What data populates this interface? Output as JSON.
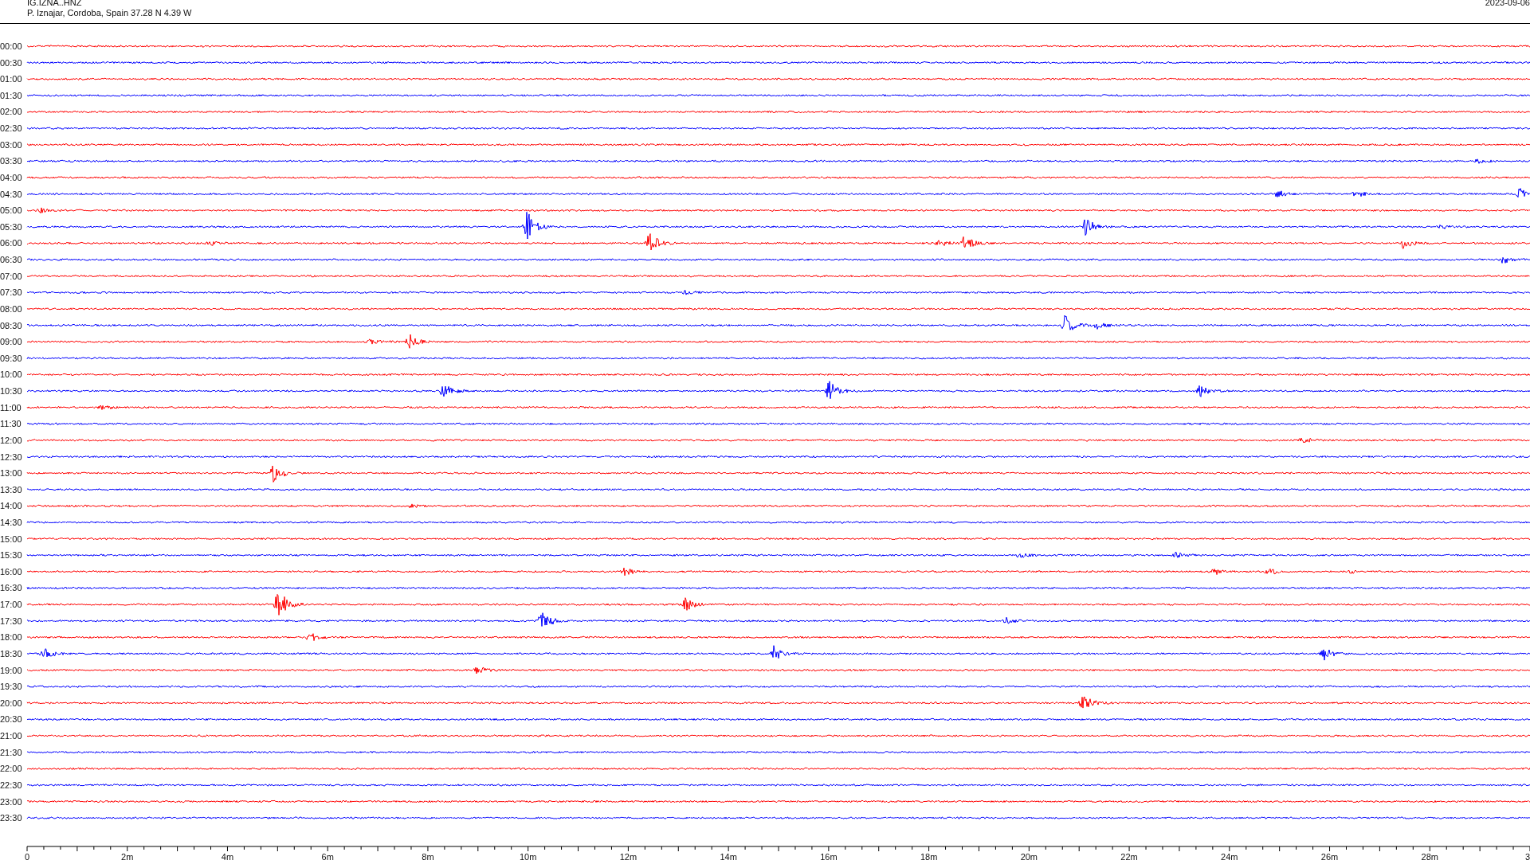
{
  "header": {
    "station": "IG.IZNA..HNZ",
    "location": "P. Iznajar, Cordoba, Spain  37.28 N 4.39 W",
    "date": "2023-09-06"
  },
  "rows": [
    {
      "label": "00:00",
      "color": "#ff0000"
    },
    {
      "label": "00:30",
      "color": "#0000ff"
    },
    {
      "label": "01:00",
      "color": "#ff0000"
    },
    {
      "label": "01:30",
      "color": "#0000ff"
    },
    {
      "label": "02:00",
      "color": "#ff0000"
    },
    {
      "label": "02:30",
      "color": "#0000ff"
    },
    {
      "label": "03:00",
      "color": "#ff0000"
    },
    {
      "label": "03:30",
      "color": "#0000ff"
    },
    {
      "label": "04:00",
      "color": "#ff0000"
    },
    {
      "label": "04:30",
      "color": "#0000ff"
    },
    {
      "label": "05:00",
      "color": "#ff0000"
    },
    {
      "label": "05:30",
      "color": "#0000ff"
    },
    {
      "label": "06:00",
      "color": "#ff0000"
    },
    {
      "label": "06:30",
      "color": "#0000ff"
    },
    {
      "label": "07:00",
      "color": "#ff0000"
    },
    {
      "label": "07:30",
      "color": "#0000ff"
    },
    {
      "label": "08:00",
      "color": "#ff0000"
    },
    {
      "label": "08:30",
      "color": "#0000ff"
    },
    {
      "label": "09:00",
      "color": "#ff0000"
    },
    {
      "label": "09:30",
      "color": "#0000ff"
    },
    {
      "label": "10:00",
      "color": "#ff0000"
    },
    {
      "label": "10:30",
      "color": "#0000ff"
    },
    {
      "label": "11:00",
      "color": "#ff0000"
    },
    {
      "label": "11:30",
      "color": "#0000ff"
    },
    {
      "label": "12:00",
      "color": "#ff0000"
    },
    {
      "label": "12:30",
      "color": "#0000ff"
    },
    {
      "label": "13:00",
      "color": "#ff0000"
    },
    {
      "label": "13:30",
      "color": "#0000ff"
    },
    {
      "label": "14:00",
      "color": "#ff0000"
    },
    {
      "label": "14:30",
      "color": "#0000ff"
    },
    {
      "label": "15:00",
      "color": "#ff0000"
    },
    {
      "label": "15:30",
      "color": "#0000ff"
    },
    {
      "label": "16:00",
      "color": "#ff0000"
    },
    {
      "label": "16:30",
      "color": "#0000ff"
    },
    {
      "label": "17:00",
      "color": "#ff0000"
    },
    {
      "label": "17:30",
      "color": "#0000ff"
    },
    {
      "label": "18:00",
      "color": "#ff0000"
    },
    {
      "label": "18:30",
      "color": "#0000ff"
    },
    {
      "label": "19:00",
      "color": "#ff0000"
    },
    {
      "label": "19:30",
      "color": "#0000ff"
    },
    {
      "label": "20:00",
      "color": "#ff0000"
    },
    {
      "label": "20:30",
      "color": "#0000ff"
    },
    {
      "label": "21:00",
      "color": "#ff0000"
    },
    {
      "label": "21:30",
      "color": "#0000ff"
    },
    {
      "label": "22:00",
      "color": "#ff0000"
    },
    {
      "label": "22:30",
      "color": "#0000ff"
    },
    {
      "label": "23:00",
      "color": "#ff0000"
    },
    {
      "label": "23:30",
      "color": "#0000ff"
    }
  ],
  "axis": {
    "ticks": [
      "0",
      "2m",
      "4m",
      "6m",
      "8m",
      "10m",
      "12m",
      "14m",
      "16m",
      "18m",
      "20m",
      "22m",
      "24m",
      "26m",
      "28m",
      "3"
    ]
  }
}
